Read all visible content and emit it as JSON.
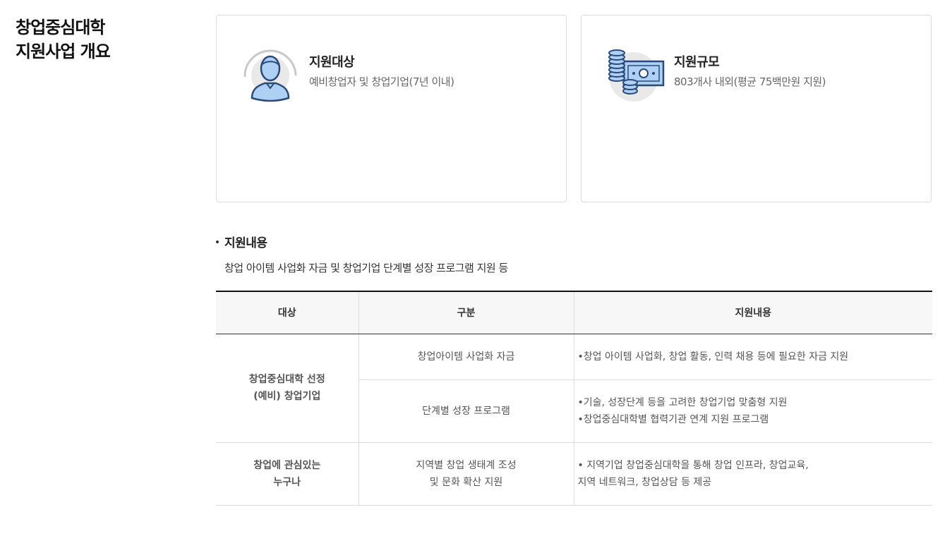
{
  "page_title": {
    "line1": "창업중심대학",
    "line2": "지원사업 개요"
  },
  "cards": [
    {
      "icon": "person-icon",
      "title": "지원대상",
      "desc": "예비창업자 및 창업기업(7년 이내)"
    },
    {
      "icon": "money-icon",
      "title": "지원규모",
      "desc": "803개사 내외(평균 75백만원 지원)"
    }
  ],
  "section": {
    "heading": "지원내용",
    "desc": "창업 아이템 사업화 자금 및 창업기업 단계별 성장 프로그램 지원 등"
  },
  "table": {
    "headers": [
      "대상",
      "구분",
      "지원내용"
    ],
    "rows": [
      {
        "target_line1": "창업중심대학 선정",
        "target_line2": "(예비) 창업기업",
        "category": "창업아이템 사업화 자금",
        "content_line1": "•창업 아이템 사업화, 창업 활동, 인력 채용 등에 필요한 자금 지원"
      },
      {
        "category": "단계별 성장 프로그램",
        "content_line1": "•기술, 성장단계 등을 고려한 창업기업 맞춤형 지원",
        "content_line2": "•창업중심대학별 협력기관 연계 지원 프로그램"
      },
      {
        "target_line1": "창업에 관심있는",
        "target_line2": "누구나",
        "category_line1": "지역별 창업 생태계 조성",
        "category_line2": "및 문화 확산 지원",
        "content_line1": "• 지역기업 창업중심대학을 통해 창업 인프라, 창업교육,",
        "content_line2": "지역 네트워크, 창업상담 등 제공"
      }
    ]
  },
  "colors": {
    "icon_fill": "#aed0f5",
    "icon_stroke": "#2b4a78",
    "icon_bg": "#e9e9e9"
  }
}
